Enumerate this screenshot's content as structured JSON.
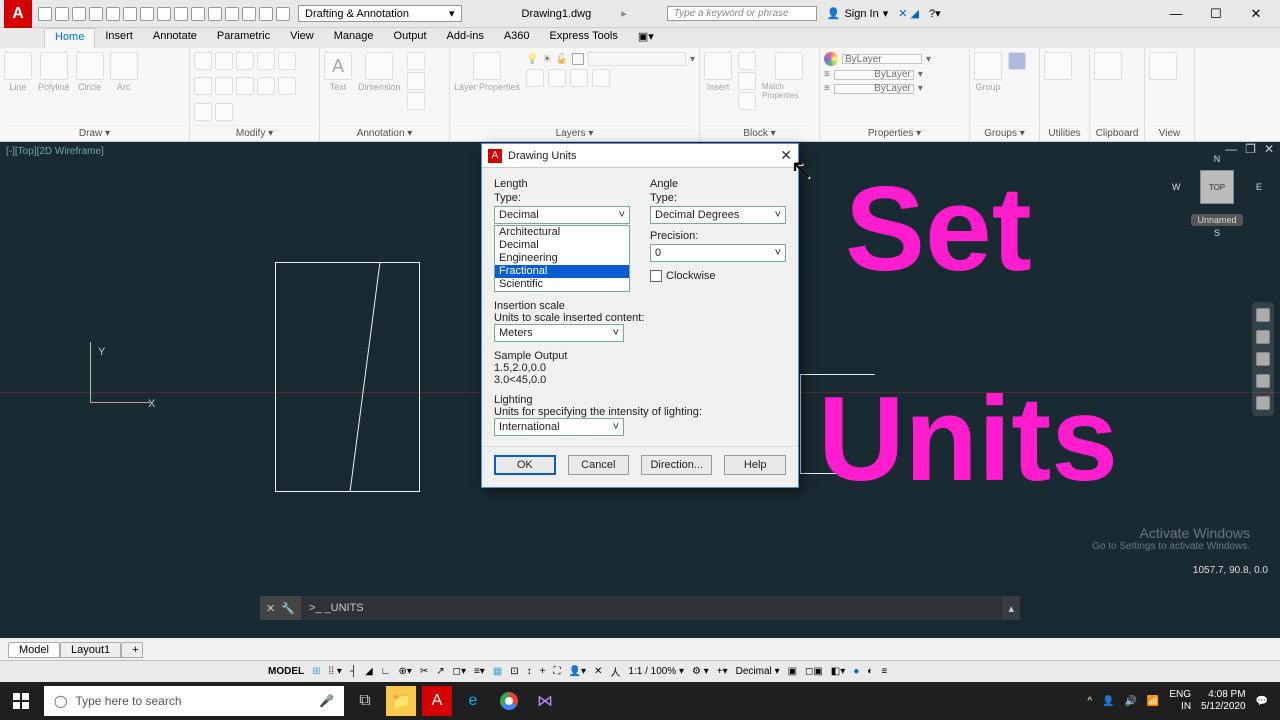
{
  "titlebar": {
    "workspace": "Drafting & Annotation",
    "document": "Drawing1.dwg",
    "search_placeholder": "Type a keyword or phrase",
    "signin": "Sign In"
  },
  "ribbon_tabs": [
    "Home",
    "Insert",
    "Annotate",
    "Parametric",
    "View",
    "Manage",
    "Output",
    "Add-ins",
    "A360",
    "Express Tools"
  ],
  "ribbon_panels": {
    "draw": {
      "title": "Draw ▾",
      "tools": [
        "Line",
        "Polyline",
        "Circle",
        "Arc"
      ]
    },
    "modify": {
      "title": "Modify ▾"
    },
    "annotation": {
      "title": "Annotation ▾",
      "tools": [
        "Text",
        "Dimension"
      ]
    },
    "layers": {
      "title": "Layers ▾",
      "tool": "Layer Properties"
    },
    "block": {
      "title": "Block ▾",
      "tools": [
        "Insert",
        "Match Properties"
      ]
    },
    "properties": {
      "title": "Properties ▾",
      "bylayer": "ByLayer"
    },
    "groups": {
      "title": "Groups ▾",
      "tool": "Group"
    },
    "utilities": {
      "title": "Utilities"
    },
    "clipboard": {
      "title": "Clipboard"
    },
    "view": {
      "title": "View"
    }
  },
  "canvas": {
    "view_label": "[-][Top][2D Wireframe]",
    "axis_x": "X",
    "axis_y": "Y",
    "coord_readout": "1057.7, 90.8, 0.0",
    "activate_title": "Activate Windows",
    "activate_sub": "Go to Settings to activate Windows.",
    "viewcube": {
      "top": "TOP",
      "n": "N",
      "s": "S",
      "e": "E",
      "w": "W",
      "label": "Unnamed"
    }
  },
  "dialog": {
    "title": "Drawing Units",
    "length_label": "Length",
    "angle_label": "Angle",
    "type_label": "Type:",
    "precision_label": "Precision:",
    "length_type_value": "Decimal",
    "length_options": [
      "Architectural",
      "Decimal",
      "Engineering",
      "Fractional",
      "Scientific"
    ],
    "length_selected_idx": 3,
    "angle_type_value": "Decimal Degrees",
    "angle_precision_value": "0",
    "clockwise_label": "Clockwise",
    "insertion_title": "Insertion scale",
    "insertion_sub": "Units to scale inserted content:",
    "insertion_value": "Meters",
    "sample_title": "Sample Output",
    "sample1": "1.5,2.0,0.0",
    "sample2": "3.0<45,0.0",
    "lighting_title": "Lighting",
    "lighting_sub": "Units for specifying the intensity of lighting:",
    "lighting_value": "International",
    "btn_ok": "OK",
    "btn_cancel": "Cancel",
    "btn_direction": "Direction...",
    "btn_help": "Help"
  },
  "overlay": {
    "line1": "Set",
    "line2": "Units"
  },
  "cmdline": {
    "prefix": ">_",
    "text": "_UNITS"
  },
  "layouts": {
    "model": "Model",
    "layout1": "Layout1",
    "add": "+"
  },
  "statusbar": {
    "model": "MODEL",
    "scale": "1:1 / 100% ▾",
    "units": "Decimal ▾"
  },
  "taskbar": {
    "search_placeholder": "Type here to search",
    "lang": "ENG",
    "region": "IN",
    "time": "4:08 PM",
    "date": "5/12/2020"
  }
}
